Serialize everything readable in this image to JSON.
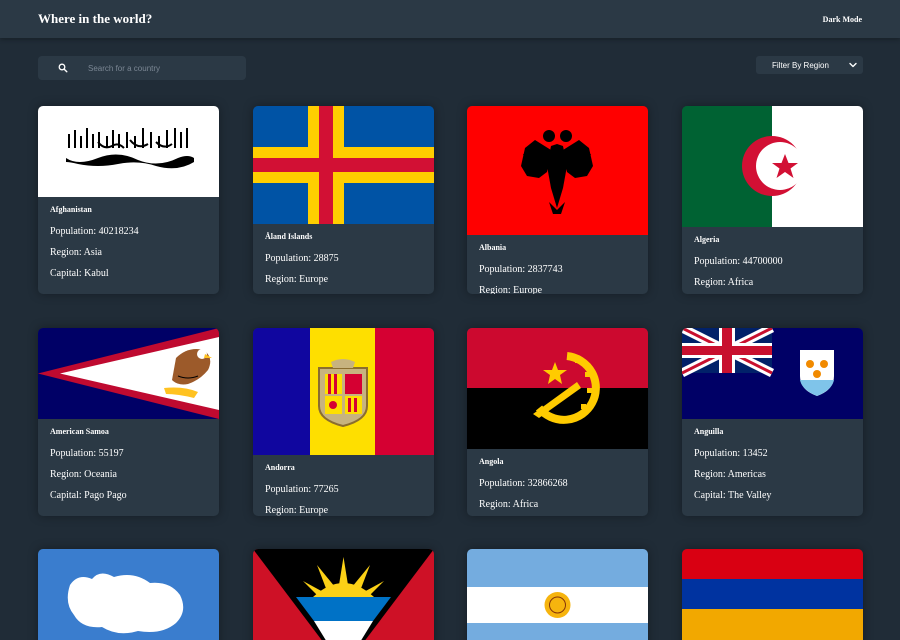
{
  "header": {
    "title": "Where in the world?",
    "mode_toggle": "Dark Mode"
  },
  "search": {
    "placeholder": "Search for a country",
    "value": ""
  },
  "filter": {
    "label": "Filter By Region"
  },
  "labels": {
    "population": "Population: ",
    "region": "Region: ",
    "capital": "Capital: "
  },
  "countries": [
    {
      "name": "Afghanistan",
      "population": "40218234",
      "region": "Asia",
      "capital": "Kabul"
    },
    {
      "name": "Åland Islands",
      "population": "28875",
      "region": "Europe",
      "capital": ""
    },
    {
      "name": "Albania",
      "population": "2837743",
      "region": "Europe",
      "capital": ""
    },
    {
      "name": "Algeria",
      "population": "44700000",
      "region": "Africa",
      "capital": ""
    },
    {
      "name": "American Samoa",
      "population": "55197",
      "region": "Oceania",
      "capital": "Pago Pago"
    },
    {
      "name": "Andorra",
      "population": "77265",
      "region": "Europe",
      "capital": ""
    },
    {
      "name": "Angola",
      "population": "32866268",
      "region": "Africa",
      "capital": ""
    },
    {
      "name": "Anguilla",
      "population": "13452",
      "region": "Americas",
      "capital": "The Valley"
    },
    {
      "name": "",
      "population": "",
      "region": "",
      "capital": ""
    },
    {
      "name": "",
      "population": "",
      "region": "",
      "capital": ""
    },
    {
      "name": "",
      "population": "",
      "region": "",
      "capital": ""
    },
    {
      "name": "",
      "population": "",
      "region": "",
      "capital": ""
    }
  ],
  "colors": {
    "background": "#202c37",
    "elements": "#2b3945",
    "text": "#ffffff"
  }
}
